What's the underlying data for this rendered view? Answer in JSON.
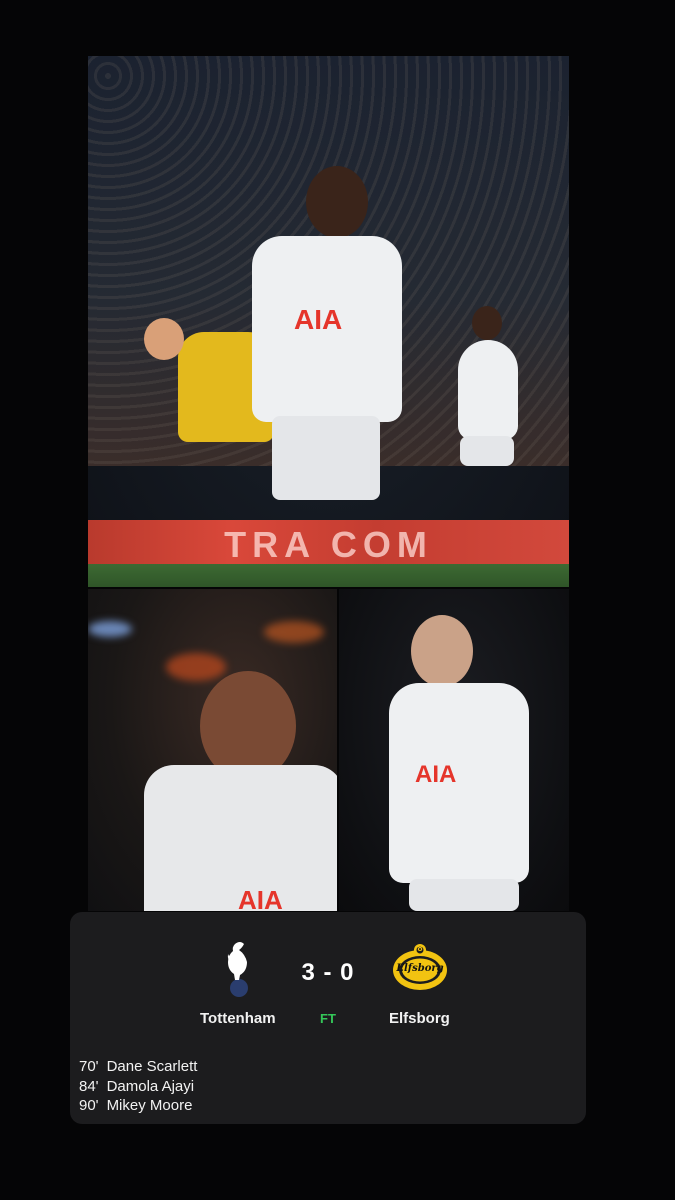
{
  "photos": {
    "main": {
      "board_text": "TRA  COM",
      "shirt_sponsor": "AIA"
    },
    "left": {
      "shirt_sponsor": "AIA"
    },
    "right": {
      "shirt_sponsor": "AIA"
    }
  },
  "match": {
    "home_team": "Tottenham",
    "away_team": "Elfsborg",
    "score": "3 - 0",
    "status": "FT",
    "away_badge_text": "Elfsborg",
    "away_badge_number": "8",
    "status_color": "#34c759"
  },
  "scorers": [
    {
      "minute": "70'",
      "name": "Dane Scarlett"
    },
    {
      "minute": "84'",
      "name": "Damola Ajayi"
    },
    {
      "minute": "90'",
      "name": "Mikey Moore"
    }
  ],
  "icons": {
    "home_badge": "cockerel-icon",
    "away_badge": "elfsborg-crest-icon"
  }
}
